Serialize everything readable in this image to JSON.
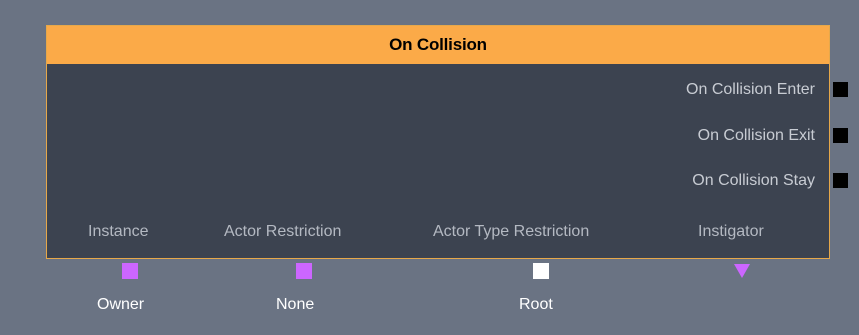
{
  "node": {
    "title": "On Collision",
    "header_color": "#fbaa48",
    "outputs": [
      {
        "label": "On Collision Enter",
        "pin_color": "#000000"
      },
      {
        "label": "On Collision Exit",
        "pin_color": "#000000"
      },
      {
        "label": "On Collision Stay",
        "pin_color": "#000000"
      }
    ],
    "inputs": [
      {
        "label": "Instance",
        "pin_color": "#cc66ff",
        "pin_shape": "square",
        "value": "Owner"
      },
      {
        "label": "Actor Restriction",
        "pin_color": "#cc66ff",
        "pin_shape": "square",
        "value": "None"
      },
      {
        "label": "Actor Type Restriction",
        "pin_color": "#ffffff",
        "pin_shape": "square",
        "value": "Root"
      },
      {
        "label": "Instigator",
        "pin_color": "#cc66ff",
        "pin_shape": "triangle",
        "value": ""
      }
    ]
  }
}
